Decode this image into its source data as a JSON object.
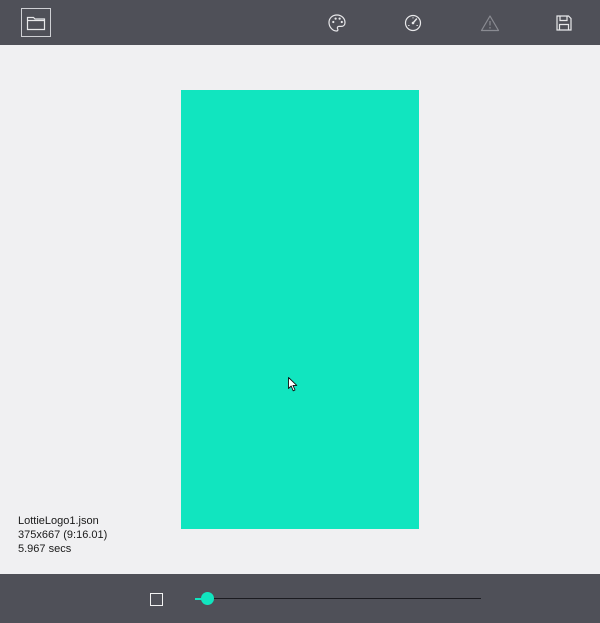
{
  "colors": {
    "toolbar_background": "#4f5058",
    "canvas_background": "#f0f0f2",
    "animation_background": "#11e5bf",
    "icon_color": "#e8e8ea",
    "disabled_icon_color": "#8a8b92"
  },
  "toolbar": {
    "items": [
      {
        "icon": "folder-icon",
        "state": "active"
      },
      {
        "icon": "palette-icon",
        "state": "enabled"
      },
      {
        "icon": "speedometer-icon",
        "state": "enabled"
      },
      {
        "icon": "warning-icon",
        "state": "disabled"
      },
      {
        "icon": "save-icon",
        "state": "enabled"
      }
    ]
  },
  "file_info": {
    "file_name": "LottieLogo1.json",
    "dimensions": "375x667 (9:16.01)",
    "duration": "5.967 secs"
  },
  "playback": {
    "stop_icon": "stop-icon",
    "progress": 0.02
  }
}
